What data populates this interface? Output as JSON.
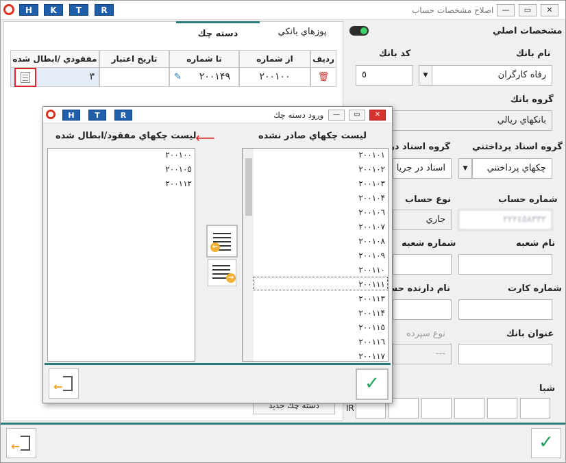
{
  "window": {
    "title": "اصلاح مشخصات حساب",
    "hotkeys": [
      "H",
      "K",
      "T",
      "R"
    ],
    "controls": {
      "close": "✕",
      "restore": "▭",
      "minimize": "—"
    }
  },
  "right_panel": {
    "header": "مشخصات اصلي",
    "toggle_on": true,
    "bank_name_label": "نام بانك",
    "bank_name_value": "رفاه کارگران",
    "bank_code_label": "كد بانك",
    "bank_code_value": "٥",
    "bank_group_label": "گروه بانك",
    "bank_group_value": "بانكهاي ريالي",
    "payment_docs_group_label": "گروه اسناد پرداختني",
    "payment_docs_group_value": "چكهاي پرداختني",
    "receipt_docs_group_label": "گروه اسناد دريا",
    "receipt_docs_group_value": "اسناد در جريا",
    "account_number_label": "شماره حساب",
    "account_number_value": "٢٢٢٤٥٨٣٣٢",
    "account_type_label": "نوع حساب",
    "account_type_value": "جاري",
    "branch_name_label": "نام شعبه",
    "branch_number_label": "شماره شعبه",
    "card_number_label": "شماره كارت",
    "holder_name_label": "نام دارنده حسا",
    "bank_title_label": "عنوان بانك",
    "deposit_type_label": "نوع سپرده",
    "deposit_type_value": "---",
    "sheba_label": "شبا",
    "sheba_prefix": "IR"
  },
  "left_panel": {
    "tabs": [
      {
        "label": "پوزهاي بانكي",
        "active": false
      },
      {
        "label": "دسته چك",
        "active": true
      }
    ],
    "grid_headers": [
      "رديف",
      "از شماره",
      "تا شماره",
      "تاريخ اعتبار",
      "مفقودي /ابطال شده"
    ],
    "grid_row": {
      "from": "٢٠٠١٠٠",
      "to": "٢٠٠١۴٩",
      "validity": "",
      "lost_count": "٣"
    },
    "new_checkbook_button": "دسته چك جديد"
  },
  "dialog": {
    "title": "ورود دسته چك",
    "hotkeys": [
      "H",
      "T",
      "R"
    ],
    "unissued_header": "ليست چكهاي صادر نشده",
    "lost_header": "ليست چكهاي مفقود/ابطال شده",
    "unissued_items": [
      "٢٠٠١٠١",
      "٢٠٠١٠٢",
      "٢٠٠١٠٣",
      "٢٠٠١٠۴",
      "٢٠٠١٠٦",
      "٢٠٠١٠٧",
      "٢٠٠١٠٨",
      "٢٠٠١٠٩",
      "٢٠٠١١٠",
      "٢٠٠١١١",
      "٢٠٠١١٣",
      "٢٠٠١١۴",
      "٢٠٠١١٥",
      "٢٠٠١١٦",
      "٢٠٠١١٧"
    ],
    "selected_index": 9,
    "lost_items": [
      "٢٠٠١٠٠",
      "٢٠٠١٠٥",
      "٢٠٠١١٢"
    ]
  },
  "colors": {
    "accent": "#2a7d7a",
    "hotkey": "#1f5ea8",
    "highlight": "#d9262c",
    "ok": "#20a05a",
    "arrow": "#f2b134"
  }
}
